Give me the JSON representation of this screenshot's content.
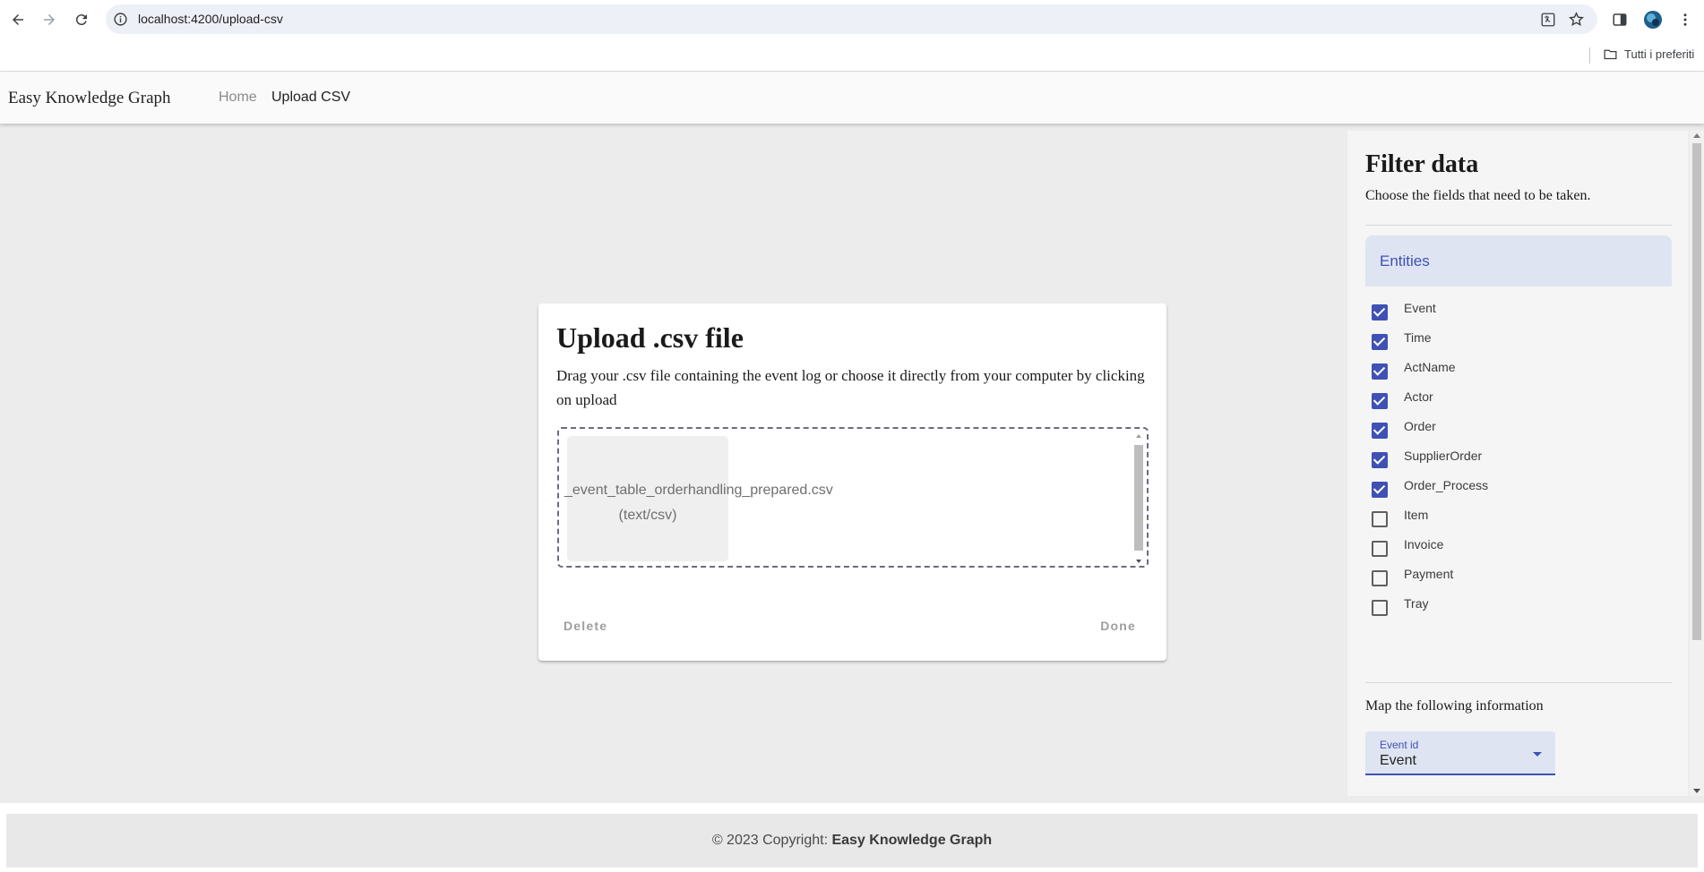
{
  "browser": {
    "url": "localhost:4200/upload-csv",
    "bookmark_folder": "Tutti i preferiti"
  },
  "header": {
    "brand": "Easy Knowledge Graph",
    "nav": [
      {
        "label": "Home"
      },
      {
        "label": "Upload CSV"
      }
    ]
  },
  "upload": {
    "title": "Upload .csv file",
    "description": "Drag your .csv file containing the event log or choose it directly from your computer by clicking on upload",
    "file_name": "_event_table_orderhandling_prepared.csv",
    "file_type": "(text/csv)",
    "delete_label": "Delete",
    "done_label": "Done"
  },
  "filter": {
    "title": "Filter data",
    "subtitle": "Choose the fields that need to be taken.",
    "entities_label": "Entities",
    "entities": [
      {
        "label": "Event",
        "checked": true
      },
      {
        "label": "Time",
        "checked": true
      },
      {
        "label": "ActName",
        "checked": true
      },
      {
        "label": "Actor",
        "checked": true
      },
      {
        "label": "Order",
        "checked": true
      },
      {
        "label": "SupplierOrder",
        "checked": true
      },
      {
        "label": "Order_Process",
        "checked": true
      },
      {
        "label": "Item",
        "checked": false
      },
      {
        "label": "Invoice",
        "checked": false
      },
      {
        "label": "Payment",
        "checked": false
      },
      {
        "label": "Tray",
        "checked": false
      }
    ],
    "map_title": "Map the following information",
    "event_id_select": {
      "label": "Event id",
      "value": "Event"
    }
  },
  "footer": {
    "prefix": "© 2023 Copyright: ",
    "brand": "Easy Knowledge Graph"
  },
  "colors": {
    "primary": "#3f51b5",
    "primary_tint": "#dfe4f2",
    "background": "#ececec"
  }
}
